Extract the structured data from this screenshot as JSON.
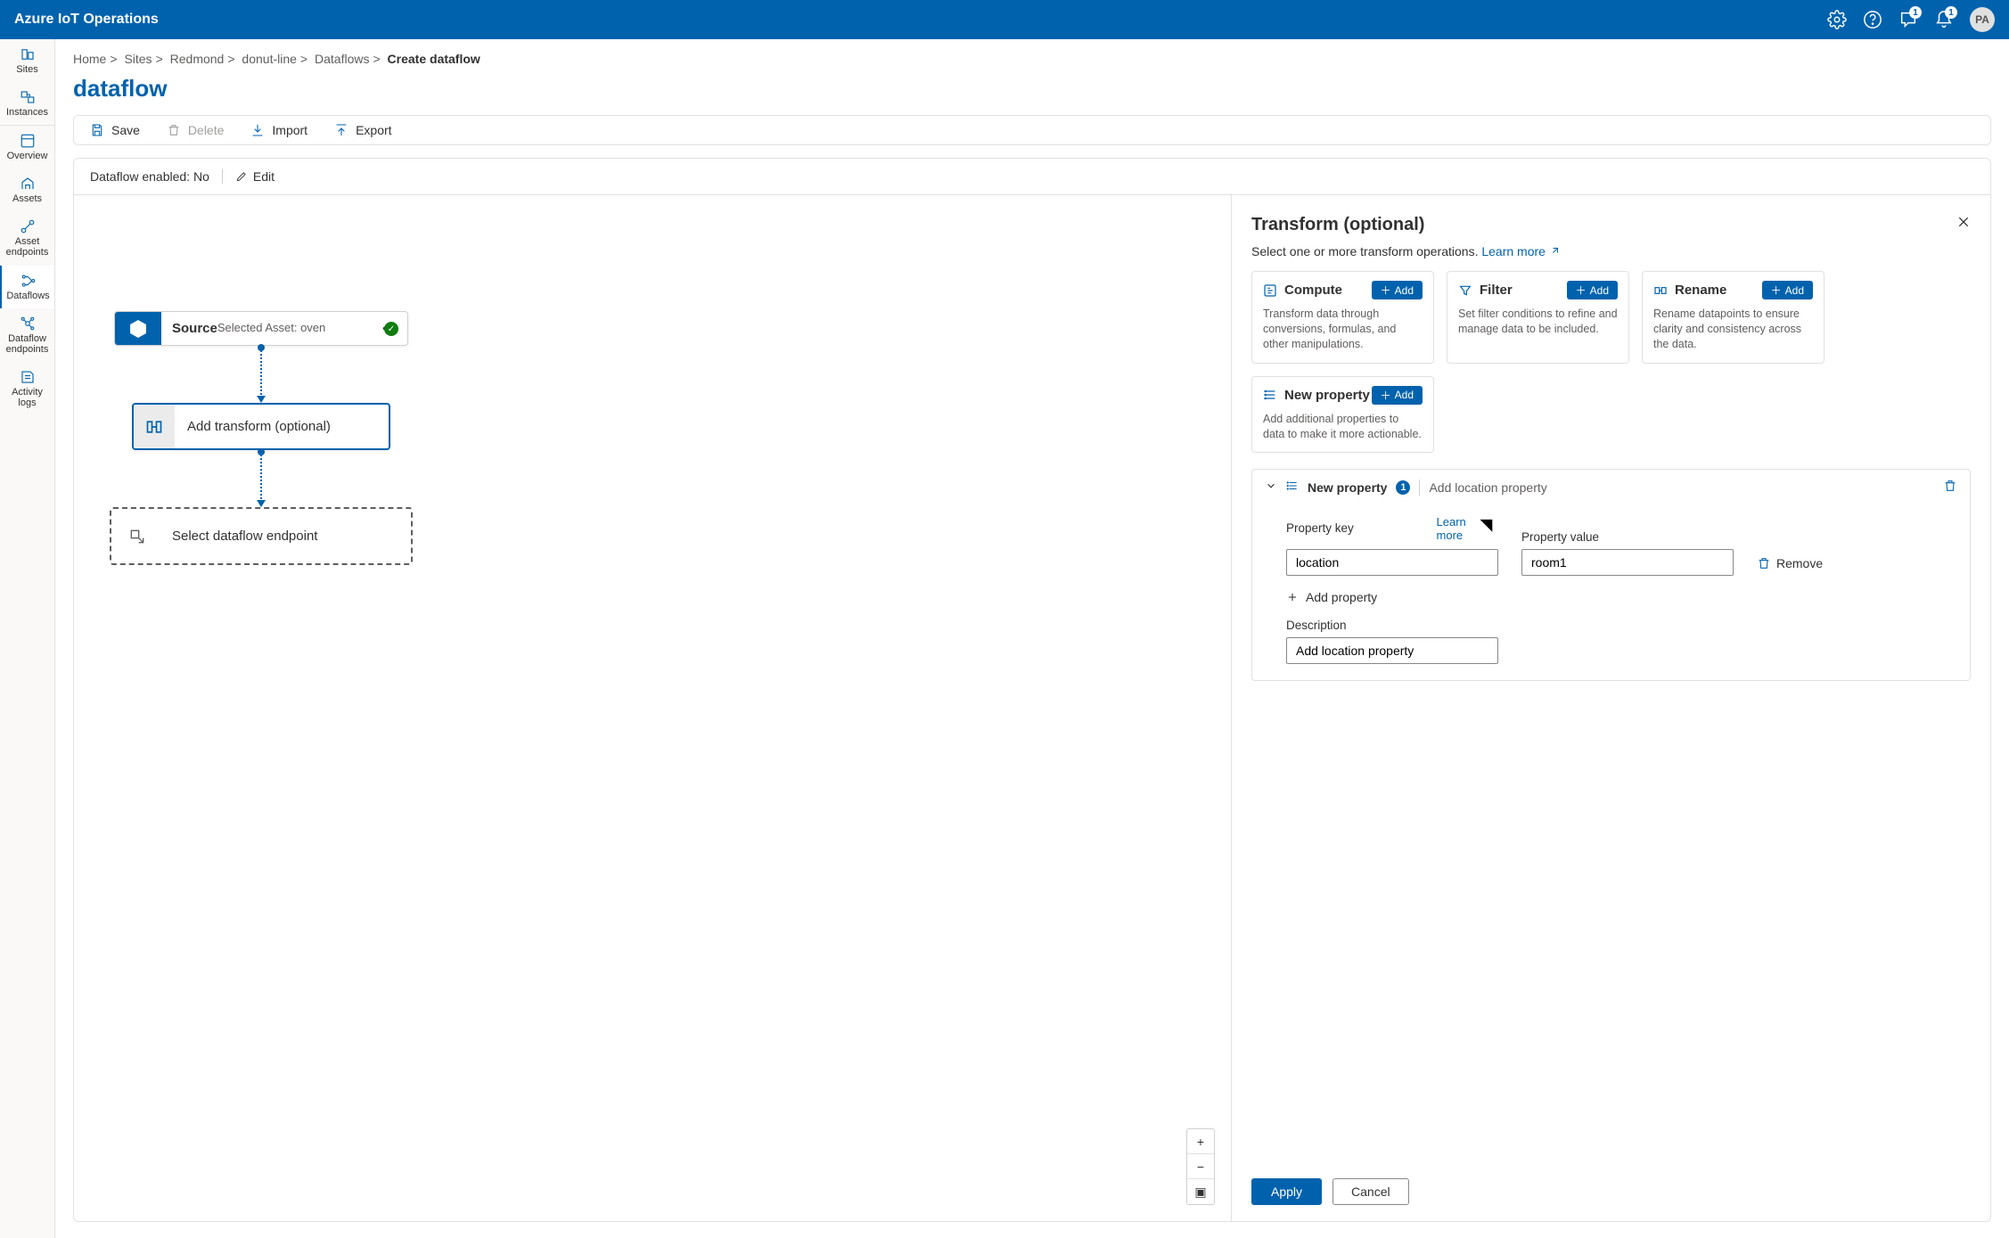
{
  "app": {
    "title": "Azure IoT Operations"
  },
  "header": {
    "notif1_badge": "1",
    "notif2_badge": "1",
    "avatar_initials": "PA"
  },
  "leftnav": {
    "items": [
      {
        "label": "Sites"
      },
      {
        "label": "Instances"
      },
      {
        "label": "Overview"
      },
      {
        "label": "Assets"
      },
      {
        "label": "Asset endpoints"
      },
      {
        "label": "Dataflows"
      },
      {
        "label": "Dataflow endpoints"
      },
      {
        "label": "Activity logs"
      }
    ]
  },
  "breadcrumb": {
    "items": [
      "Home",
      "Sites",
      "Redmond",
      "donut-line",
      "Dataflows"
    ],
    "current": "Create dataflow"
  },
  "page": {
    "title": "dataflow"
  },
  "toolbar": {
    "save": "Save",
    "delete": "Delete",
    "import": "Import",
    "export": "Export"
  },
  "status": {
    "label": "Dataflow enabled: No",
    "edit": "Edit"
  },
  "flow": {
    "source": {
      "title": "Source",
      "subtitle": "Selected Asset: oven"
    },
    "transform": {
      "label": "Add transform (optional)"
    },
    "endpoint": {
      "label": "Select dataflow endpoint"
    }
  },
  "panel": {
    "title": "Transform (optional)",
    "subtitle_prefix": "Select one or more transform operations. ",
    "learn_more": "Learn more",
    "ops": [
      {
        "name": "Compute",
        "desc": "Transform data through conversions, formulas, and other manipulations.",
        "add": "Add"
      },
      {
        "name": "Filter",
        "desc": "Set filter conditions to refine and manage data to be included.",
        "add": "Add"
      },
      {
        "name": "Rename",
        "desc": "Rename datapoints to ensure clarity and consistency across the data.",
        "add": "Add"
      },
      {
        "name": "New property",
        "desc": "Add additional properties to data to make it more actionable.",
        "add": "Add"
      }
    ],
    "newprop": {
      "heading": "New property",
      "count": "1",
      "subtitle": "Add location property",
      "key_label": "Property key",
      "value_label": "Property value",
      "learn_more": "Learn more",
      "key_value": "location",
      "value_value": "room1",
      "remove": "Remove",
      "add_property": "Add property",
      "description_label": "Description",
      "description_value": "Add location property"
    },
    "apply": "Apply",
    "cancel": "Cancel"
  }
}
